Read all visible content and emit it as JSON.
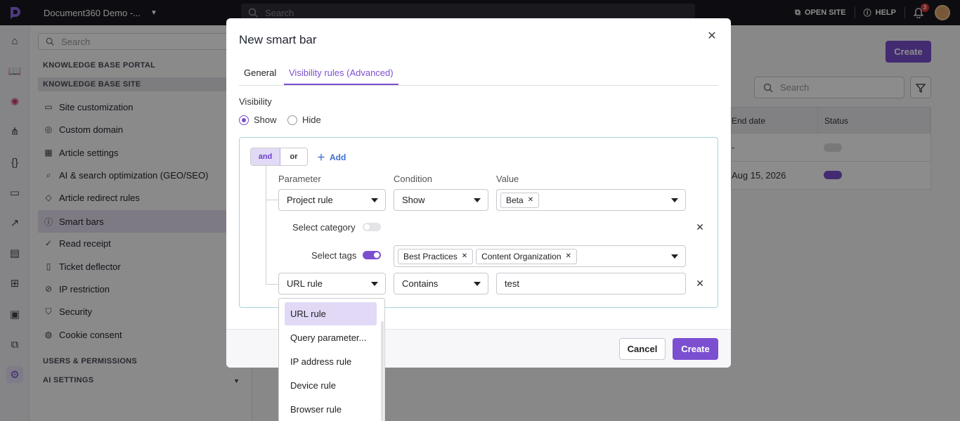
{
  "topbar": {
    "project_name": "Document360 Demo -...",
    "search_placeholder": "Search",
    "open_site": "OPEN SITE",
    "help": "HELP",
    "notification_count": "3"
  },
  "sidebar": {
    "search_placeholder": "Search",
    "section_portal": "KNOWLEDGE BASE PORTAL",
    "section_site": "KNOWLEDGE BASE SITE",
    "items": [
      {
        "label": "Site customization",
        "icon": "monitor-icon"
      },
      {
        "label": "Custom domain",
        "icon": "globe-icon"
      },
      {
        "label": "Article settings",
        "icon": "article-settings-icon"
      },
      {
        "label": "AI & search optimization (GEO/SEO)",
        "icon": "search-ai-icon"
      },
      {
        "label": "Article redirect rules",
        "icon": "redirect-icon"
      },
      {
        "label": "Smart bars",
        "icon": "info-icon"
      },
      {
        "label": "Read receipt",
        "icon": "check-circle-icon"
      },
      {
        "label": "Ticket deflector",
        "icon": "ticket-icon"
      },
      {
        "label": "IP restriction",
        "icon": "block-icon"
      },
      {
        "label": "Security",
        "icon": "shield-icon"
      },
      {
        "label": "Cookie consent",
        "icon": "cookie-icon"
      }
    ],
    "section_users": "USERS & PERMISSIONS",
    "section_ai": "AI SETTINGS"
  },
  "main": {
    "create_label": "Create",
    "search_placeholder": "Search",
    "col_end_date": "End date",
    "col_status": "Status",
    "rows": [
      {
        "end_date": "-",
        "status_on": false
      },
      {
        "end_date": "Aug 15, 2026",
        "status_on": true
      }
    ]
  },
  "modal": {
    "title": "New smart bar",
    "tabs": [
      "General",
      "Visibility rules (Advanced)"
    ],
    "active_tab": 1,
    "visibility_label": "Visibility",
    "show_label": "Show",
    "hide_label": "Hide",
    "visibility_value": "Show",
    "logic_and": "and",
    "logic_or": "or",
    "add_label": "Add",
    "col_parameter": "Parameter",
    "col_condition": "Condition",
    "col_value": "Value",
    "rule1": {
      "parameter": "Project rule",
      "condition": "Show",
      "value_chips": [
        "Beta"
      ],
      "select_category_label": "Select category",
      "select_category_on": false,
      "select_tags_label": "Select tags",
      "select_tags_on": true,
      "tag_chips": [
        "Best Practices",
        "Content Organization"
      ]
    },
    "rule2": {
      "parameter": "URL rule",
      "condition": "Contains",
      "value": "test"
    },
    "cancel_label": "Cancel",
    "create_label": "Create"
  },
  "parameter_dropdown": {
    "options": [
      "URL rule",
      "Query parameter...",
      "IP address rule",
      "Device rule",
      "Browser rule"
    ],
    "selected": "URL rule"
  },
  "colors": {
    "accent": "#7b4fd0",
    "topbar": "#18181f",
    "link": "#3b6ed0"
  }
}
